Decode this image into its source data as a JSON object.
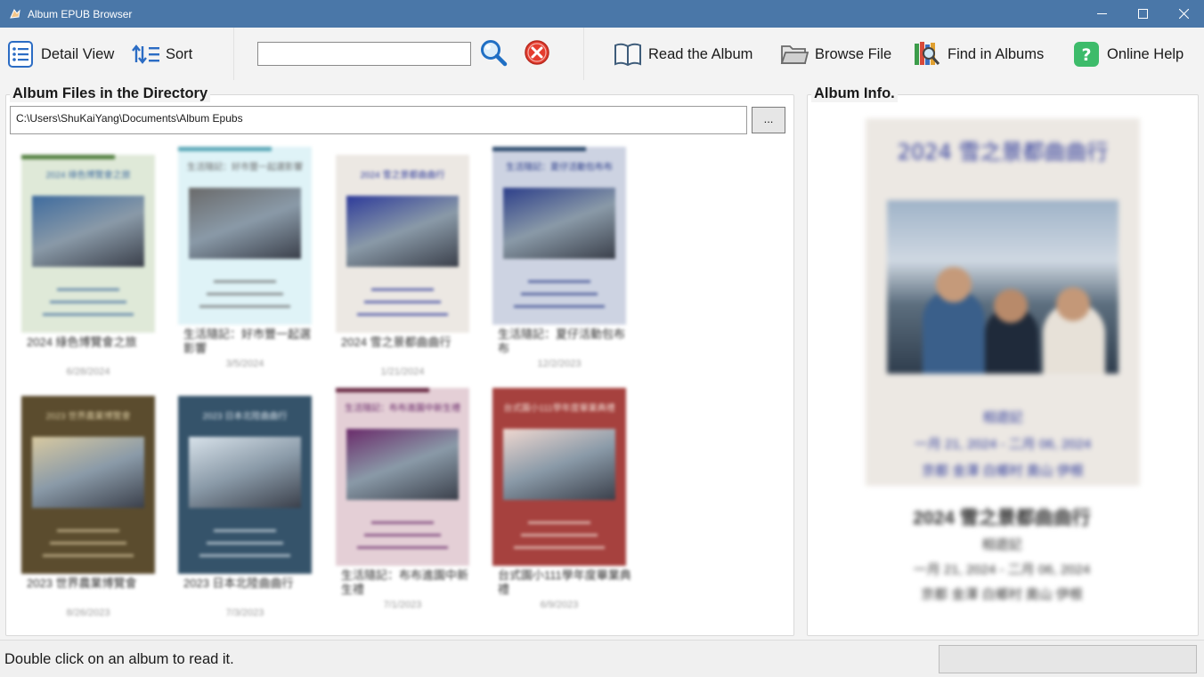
{
  "window": {
    "title": "Album EPUB Browser"
  },
  "toolbar": {
    "detail_view_label": "Detail View",
    "sort_label": "Sort",
    "search_value": "",
    "search_placeholder": "",
    "read_album_label": "Read the Album",
    "browse_file_label": "Browse File",
    "find_in_albums_label": "Find in Albums",
    "online_help_label": "Online Help"
  },
  "left_panel": {
    "title": "Album Files in the Directory",
    "path": "C:\\Users\\ShuKaiYang\\Documents\\Album Epubs",
    "browse_button_label": "..."
  },
  "albums": [
    {
      "name": "2024 綠色博覽會之旅",
      "date": "6/28/2024",
      "cover_bg": "#dfe9d8",
      "bar_color": "#4f7d3c",
      "accent": "#3e6b9e"
    },
    {
      "name": "生活隨記：好市豐一起選影響",
      "date": "3/5/2024",
      "cover_bg": "#dff3f7",
      "bar_color": "#5aa8b8",
      "accent": "#6a6a6a"
    },
    {
      "name": "2024 雪之景都曲曲行",
      "date": "1/21/2024",
      "cover_bg": "#ece8e3",
      "bar_color": "#ece8e3",
      "accent": "#2d3a9a"
    },
    {
      "name": "生活隨記：夏仔活動包布布",
      "date": "12/2/2023",
      "cover_bg": "#cdd3e2",
      "bar_color": "#2c4a6e",
      "accent": "#2c3e8a"
    },
    {
      "name": "2023 世界農業博覽會",
      "date": "8/26/2023",
      "cover_bg": "#5b4c2e",
      "bar_color": "#5b4c2e",
      "accent": "#d8c9a0"
    },
    {
      "name": "2023 日本北陸曲曲行",
      "date": "7/3/2023",
      "cover_bg": "#35536a",
      "bar_color": "#35536a",
      "accent": "#d8e2ea"
    },
    {
      "name": "生活隨記：布布進園中新生禮",
      "date": "7/1/2023",
      "cover_bg": "#e4cfd6",
      "bar_color": "#6a2a44",
      "accent": "#6a2a6a"
    },
    {
      "name": "台式園小111學年度畢業典禮",
      "date": "6/9/2023",
      "cover_bg": "#a6413e",
      "bar_color": "#a6413e",
      "accent": "#f0d8d0"
    }
  ],
  "right_panel": {
    "title": "Album Info.",
    "album_title": "2024 雪之景都曲曲行",
    "subtitle": "相遊記",
    "dates": "一月 21, 2024 - 二月 06, 2024",
    "places": "京都 金澤 白鄉村 奧山 伊根"
  },
  "status": {
    "message": "Double click on an album to read it.",
    "progress": 0
  }
}
